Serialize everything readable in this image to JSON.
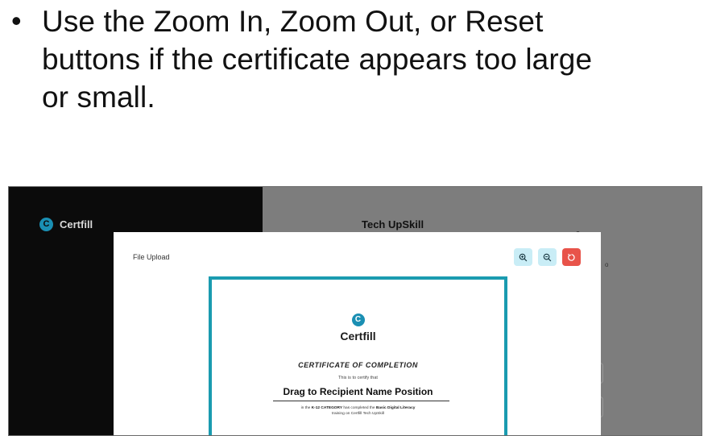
{
  "instructions": {
    "bullet": "•",
    "lines": [
      "Use the Zoom In, Zoom Out, or Reset",
      "buttons if the certificate appears too large",
      "or small."
    ]
  },
  "sidebar": {
    "logo_letter": "C",
    "brand": "Certfill",
    "background": "#0b0b0b"
  },
  "background_page": {
    "title": "Tech UpSkill",
    "small_mark": "o",
    "dot": "o"
  },
  "modal": {
    "title": "File Upload",
    "zoom_buttons": [
      {
        "name": "zoom-in",
        "icon": "zoom-in-icon"
      },
      {
        "name": "zoom-out",
        "icon": "zoom-out-icon"
      },
      {
        "name": "reset",
        "icon": "reset-icon"
      }
    ]
  },
  "certificate": {
    "logo_letter": "C",
    "brand": "Certfill",
    "heading": "CERTIFICATE OF COMPLETION",
    "certify_text": "This is to certify that",
    "recipient_placeholder": "Drag to Recipient Name Position",
    "body_prefix": "in the ",
    "category": "K-12 CATEGORY",
    "body_mid": " has completed the ",
    "course": "Basic Digital Literacy",
    "body_suffix": "training on Certfill Tech UpSkill",
    "border_color": "#1a9bb0"
  },
  "colors": {
    "accent": "#1a8fb3",
    "zoom_bg": "#c9edf6",
    "reset_bg": "#e8534a",
    "overlay": "#7d7d7d"
  }
}
